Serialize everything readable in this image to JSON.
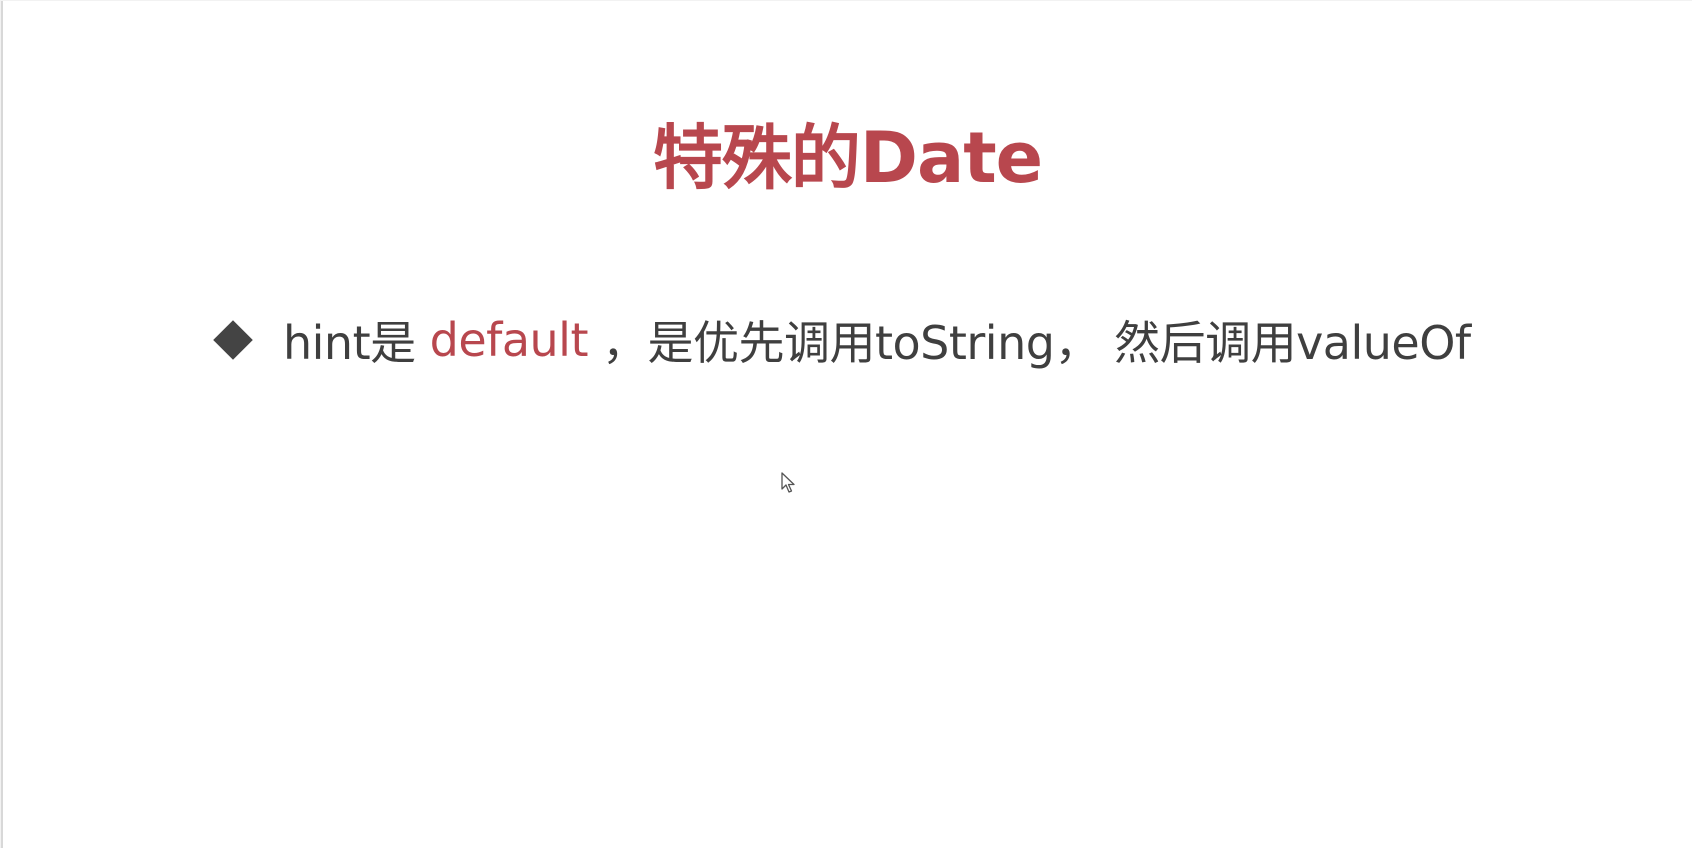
{
  "slide": {
    "title": "特殊的Date",
    "bullet": {
      "prefix": "hint是",
      "keyword": "default",
      "suffix": "，是优先调用toString， 然后调用valueOf"
    }
  },
  "colors": {
    "accent": "#b8474e",
    "text": "#3f3f3f",
    "bullet": "#444444",
    "background": "#ffffff"
  },
  "icons": {
    "bullet": "diamond-bullet-icon",
    "cursor": "mouse-pointer-icon"
  }
}
